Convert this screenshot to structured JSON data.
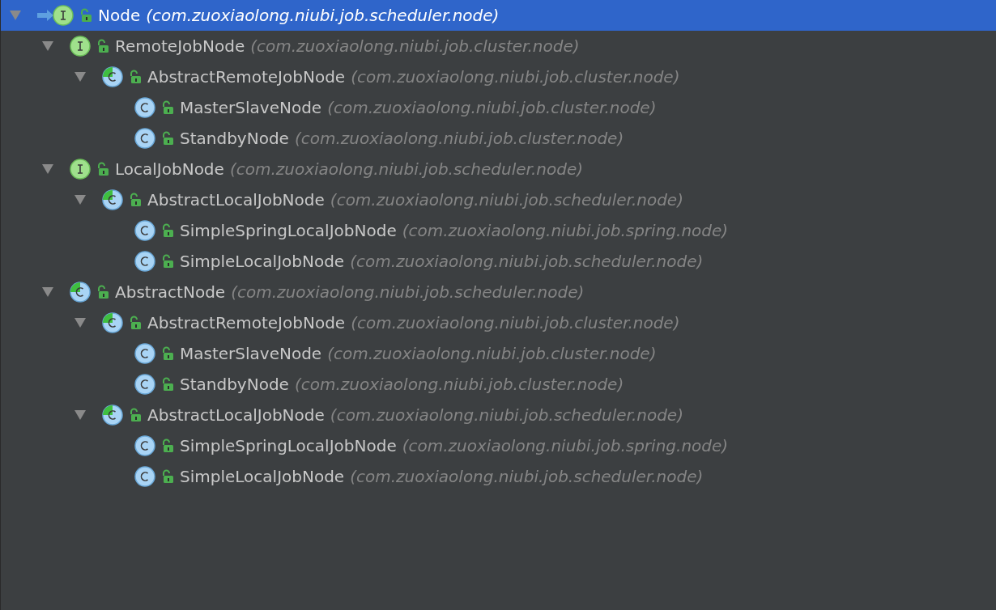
{
  "tree": [
    {
      "name": "Node",
      "package": "(com.zuoxiaolong.niubi.job.scheduler.node)",
      "kind": "interface",
      "selected": true,
      "expanded": true,
      "children": [
        {
          "name": "RemoteJobNode",
          "package": "(com.zuoxiaolong.niubi.job.cluster.node)",
          "kind": "interface",
          "selected": false,
          "expanded": true,
          "children": [
            {
              "name": "AbstractRemoteJobNode",
              "package": "(com.zuoxiaolong.niubi.job.cluster.node)",
              "kind": "abstract",
              "selected": false,
              "expanded": true,
              "children": [
                {
                  "name": "MasterSlaveNode",
                  "package": "(com.zuoxiaolong.niubi.job.cluster.node)",
                  "kind": "class",
                  "selected": false
                },
                {
                  "name": "StandbyNode",
                  "package": "(com.zuoxiaolong.niubi.job.cluster.node)",
                  "kind": "class",
                  "selected": false
                }
              ]
            }
          ]
        },
        {
          "name": "LocalJobNode",
          "package": "(com.zuoxiaolong.niubi.job.scheduler.node)",
          "kind": "interface",
          "selected": false,
          "expanded": true,
          "children": [
            {
              "name": "AbstractLocalJobNode",
              "package": "(com.zuoxiaolong.niubi.job.scheduler.node)",
              "kind": "abstract",
              "selected": false,
              "expanded": true,
              "children": [
                {
                  "name": "SimpleSpringLocalJobNode",
                  "package": "(com.zuoxiaolong.niubi.job.spring.node)",
                  "kind": "class",
                  "selected": false
                },
                {
                  "name": "SimpleLocalJobNode",
                  "package": "(com.zuoxiaolong.niubi.job.scheduler.node)",
                  "kind": "class",
                  "selected": false
                }
              ]
            }
          ]
        },
        {
          "name": "AbstractNode",
          "package": "(com.zuoxiaolong.niubi.job.scheduler.node)",
          "kind": "abstract",
          "selected": false,
          "expanded": true,
          "children": [
            {
              "name": "AbstractRemoteJobNode",
              "package": "(com.zuoxiaolong.niubi.job.cluster.node)",
              "kind": "abstract",
              "selected": false,
              "expanded": true,
              "children": [
                {
                  "name": "MasterSlaveNode",
                  "package": "(com.zuoxiaolong.niubi.job.cluster.node)",
                  "kind": "class",
                  "selected": false
                },
                {
                  "name": "StandbyNode",
                  "package": "(com.zuoxiaolong.niubi.job.cluster.node)",
                  "kind": "class",
                  "selected": false
                }
              ]
            },
            {
              "name": "AbstractLocalJobNode",
              "package": "(com.zuoxiaolong.niubi.job.scheduler.node)",
              "kind": "abstract",
              "selected": false,
              "expanded": true,
              "children": [
                {
                  "name": "SimpleSpringLocalJobNode",
                  "package": "(com.zuoxiaolong.niubi.job.spring.node)",
                  "kind": "class",
                  "selected": false
                },
                {
                  "name": "SimpleLocalJobNode",
                  "package": "(com.zuoxiaolong.niubi.job.scheduler.node)",
                  "kind": "class",
                  "selected": false
                }
              ]
            }
          ]
        }
      ]
    }
  ]
}
